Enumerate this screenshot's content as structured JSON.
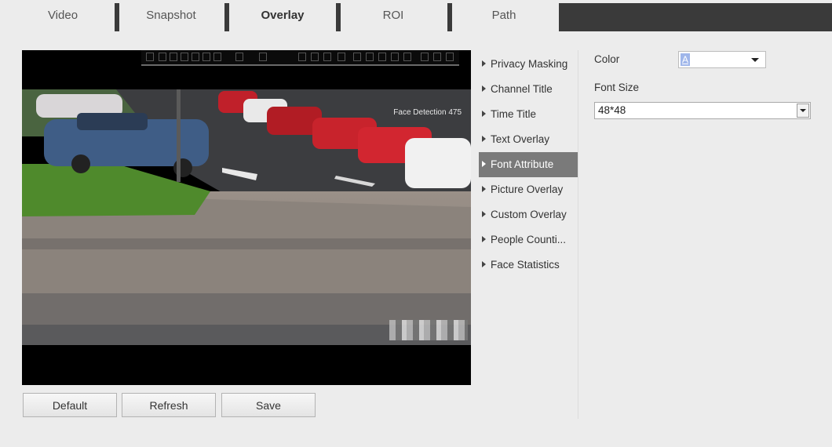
{
  "tabs": [
    {
      "label": "Video",
      "active": false
    },
    {
      "label": "Snapshot",
      "active": false
    },
    {
      "label": "Overlay",
      "active": true
    },
    {
      "label": "ROI",
      "active": false
    },
    {
      "label": "Path",
      "active": false
    }
  ],
  "preview": {
    "overlay_text": "Face Detection 475"
  },
  "menu": {
    "items": [
      {
        "label": "Privacy Masking",
        "active": false
      },
      {
        "label": "Channel Title",
        "active": false
      },
      {
        "label": "Time Title",
        "active": false
      },
      {
        "label": "Text Overlay",
        "active": false
      },
      {
        "label": "Font Attribute",
        "active": true
      },
      {
        "label": "Picture Overlay",
        "active": false
      },
      {
        "label": "Custom Overlay",
        "active": false
      },
      {
        "label": "People Counti...",
        "active": false
      },
      {
        "label": "Face Statistics",
        "active": false
      }
    ]
  },
  "attributes": {
    "color_label": "Color",
    "color_value": "A",
    "color_swatch": "#9fb6ea",
    "font_size_label": "Font Size",
    "font_size_value": "48*48"
  },
  "buttons": {
    "default_label": "Default",
    "refresh_label": "Refresh",
    "save_label": "Save"
  },
  "colors": {
    "active_menu_bg": "#7a7a7a",
    "tab_separator": "#3a3a3a",
    "page_bg": "#ececec"
  }
}
